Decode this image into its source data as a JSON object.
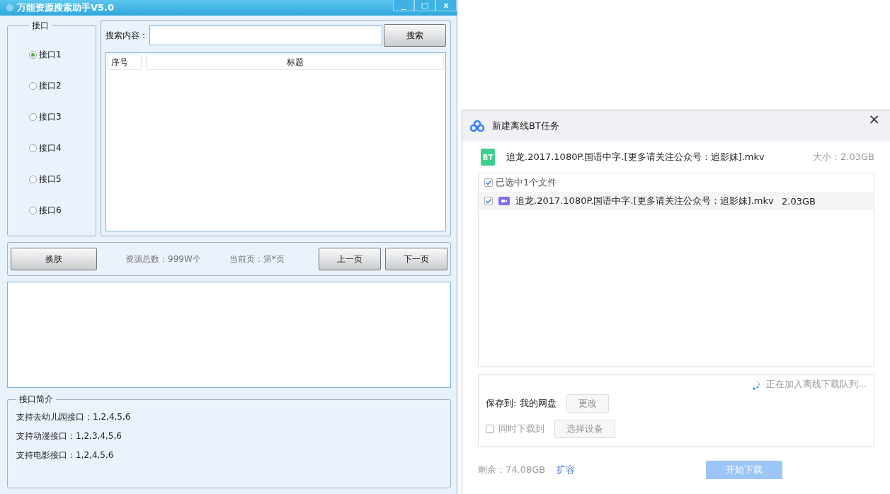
{
  "app_window": {
    "title": "万能资源搜索助手V5.0",
    "controls": [
      "_",
      "□",
      "x"
    ],
    "interface_group": {
      "title": "接口",
      "options": [
        {
          "label": "接口1",
          "selected": true
        },
        {
          "label": "接口2",
          "selected": false
        },
        {
          "label": "接口3",
          "selected": false
        },
        {
          "label": "接口4",
          "selected": false
        },
        {
          "label": "接口5",
          "selected": false
        },
        {
          "label": "接口6",
          "selected": false
        }
      ]
    },
    "search": {
      "label": "搜索内容：",
      "button": "搜索"
    },
    "results_table": {
      "columns": [
        "序号",
        "标题"
      ]
    },
    "pager": {
      "skin_button": "换肤",
      "total": "资源总数：999W个",
      "current_page": "当前页：第*页",
      "prev_button": "上一页",
      "next_button": "下一页"
    },
    "intro_group": {
      "title": "接口简介",
      "lines": [
        "支持去幼儿园接口：1,2,4,5,6",
        "支持动漫接口：1,2,3,4,5,6",
        "支持电影接口：1,2,4,5,6"
      ]
    }
  },
  "bt_dialog": {
    "title": "新建离线BT任务",
    "close": "×",
    "torrent": {
      "badge": "BT",
      "name": "追龙.2017.1080P.国语中字.[更多请关注公众号：追影妹].mkv",
      "size": "大小：2.03GB"
    },
    "select_all": {
      "label": "已选中1个文件",
      "checked": true
    },
    "files": [
      {
        "name": "追龙.2017.1080P.国语中字.[更多请关注公众号：追影妹].mkv",
        "size": "2.03GB",
        "checked": true
      }
    ],
    "status": "正在加入离线下载队列...",
    "save_to": {
      "label": "保存到: 我的网盘",
      "button": "更改"
    },
    "also_download": {
      "label": "同时下载到",
      "checked": false,
      "button": "选择设备"
    },
    "remaining": "剩余：74.08GB",
    "expand_link": "扩容",
    "start_button": {
      "label": "开始下载",
      "disabled": true
    }
  }
}
